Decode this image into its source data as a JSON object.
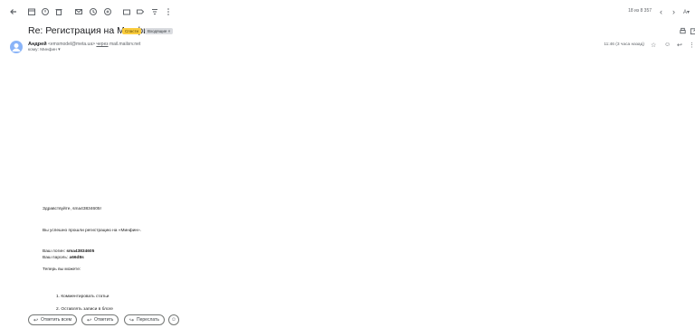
{
  "toolbar": {
    "counter": "18 из 8 357",
    "icons": [
      "back-arrow-icon",
      "archive-icon",
      "report-spam-icon",
      "delete-icon",
      "mark-unread-icon",
      "snooze-icon",
      "add-task-icon",
      "move-to-icon",
      "label-icon",
      "more-icon"
    ]
  },
  "email": {
    "subject": "Re: Регистрация на Минфин",
    "labels": [
      "Спасти",
      "Входящие ×"
    ],
    "sender_name": "Андрей",
    "sender_email": "<emsmodel@meta.ua>",
    "via_text": "через",
    "via_domain": "mail.mailsrv.net",
    "to_line": "кому: Минфин ▾",
    "time": "11:46 (3 часа назад)"
  },
  "body": {
    "greeting": "Здравствуйте, sma43834605!",
    "line1": "Вы успешно прошли регистрацию на «Минфин».",
    "login_label": "Ваш логин:",
    "login_value": "sma43834605",
    "password_label": "Ваш пароль:",
    "password_value": "a66d8s",
    "now_can": "Теперь вы можете:",
    "item1": "1. Комментировать статьи",
    "item2": "2. Оставлять записи в блоге"
  },
  "actions": {
    "reply_all": "Ответить всем",
    "reply": "Ответить",
    "forward": "Переслать"
  }
}
